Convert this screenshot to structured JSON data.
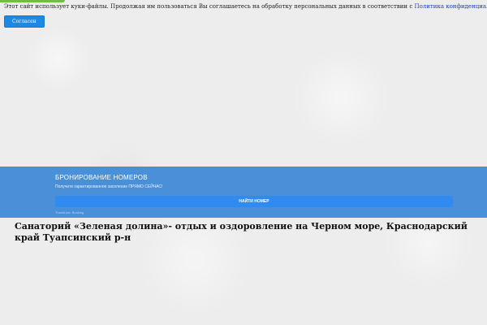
{
  "cookie": {
    "text": "Этот сайт использует куки-файлы. Продолжая им пользоваться Вы соглашаетесь на обработку персональных данных в соответствии с ",
    "link_label": "Политика конфиденциальности",
    "accept_label": "Согласен"
  },
  "booking": {
    "title": "БРОНИРОВАНИЕ НОМЕРОВ",
    "subtitle": "Получите гарантированное заселение ПРЯМО СЕЙЧАС!",
    "button_label": "НАЙТИ НОМЕР",
    "note": "TravelLine: Booking"
  },
  "page": {
    "title": "Санаторий «Зеленая долина»- отдых и оздоровление на Черном море, Краснодарский край Туапсинский р-н"
  },
  "colors": {
    "booking_band": "#4a90d9",
    "booking_button": "#2f8bf0",
    "accept_button": "#1e88e5",
    "link": "#1a3fc4"
  }
}
